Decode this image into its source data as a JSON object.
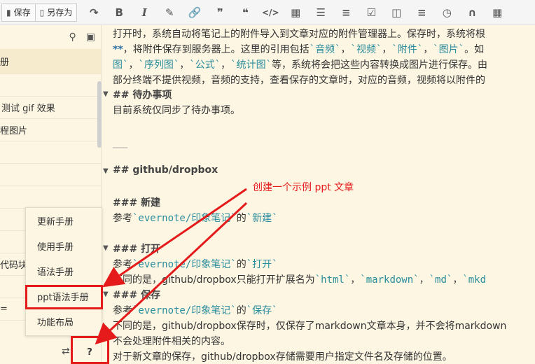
{
  "toolbar": {
    "save_label": "保存",
    "save_as_label": "另存为",
    "icons": [
      "redo-icon",
      "bold-icon",
      "italic-icon",
      "brush-icon",
      "link-icon",
      "quote-right-icon",
      "quote-left-icon",
      "code-icon",
      "file-image-icon",
      "ordered-list-icon",
      "unordered-list-icon",
      "task-list-icon",
      "html5-icon",
      "align-icon",
      "clock-icon",
      "magnet-icon",
      "table-icon"
    ]
  },
  "sidebar": {
    "items": [
      {
        "label": "册"
      },
      {
        "label": ""
      },
      {
        "label": "测试 gif 效果"
      },
      {
        "label": "程图片"
      },
      {
        "label": ""
      },
      {
        "label": ""
      },
      {
        "label": ""
      },
      {
        "label": ""
      },
      {
        "label": ""
      },
      {
        "label": "代码块"
      },
      {
        "label": ""
      },
      {
        "label": "="
      }
    ]
  },
  "menu": {
    "items": [
      {
        "label": "更新手册"
      },
      {
        "label": "使用手册"
      },
      {
        "label": "语法手册"
      },
      {
        "label": "ppt语法手册"
      },
      {
        "label": "功能布局"
      }
    ]
  },
  "help_label": "?",
  "annotation": "创建一个示例 ppt 文章",
  "editor": {
    "p1": "打开时，系统自动将笔记上的附件导入到文章对应的附件管理器上。保存时，系统将根",
    "p2_prefix": "**",
    "p2_text": "，将附件保存到服务器上。这里的引用包括",
    "c_audio": "`音频`",
    "c_video": "`视频`",
    "c_attach": "`附件`",
    "c_image": "`图片`",
    "p2_suffix": "。如",
    "p3_c1": "图`",
    "p3_c2": "`序列图`",
    "p3_c3": "`公式`",
    "p3_c4": "`统计图`",
    "p3_text": "等，系统将会把这些内容转换成图片进行保存。由",
    "p4": "部分终端不提供视频，音频的支持，查看保存的文章时，对应的音频，视频将以附件的",
    "h_todo": "## 待办事项",
    "todo_text": "目前系统仅同步了待办事项。",
    "hr": "___",
    "h_github": "## github/dropbox",
    "h_new": "### 新建",
    "ref": "参考",
    "evernote": "`evernote/印象笔记`",
    "de": "的",
    "c_new": "`新建`",
    "h_open": "### 打开",
    "c_open": "`打开`",
    "open_text": "不同的是，github/dropbox只能打开扩展名为",
    "c_html": "`html`",
    "c_md_full": "`markdown`",
    "c_md": "`md`",
    "c_mkd": "`mkd",
    "h_save": "### 保存",
    "c_save": "`保存`",
    "save_text1": "不同的是，github/dropbox保存时，仅保存了markdown文章本身，并不会将markdown",
    "save_text2": "不会处理附件相关的内容。",
    "save_text3": "对于新文章的保存，github/dropbox存储需要用户指定文件名及存储的位置。"
  }
}
